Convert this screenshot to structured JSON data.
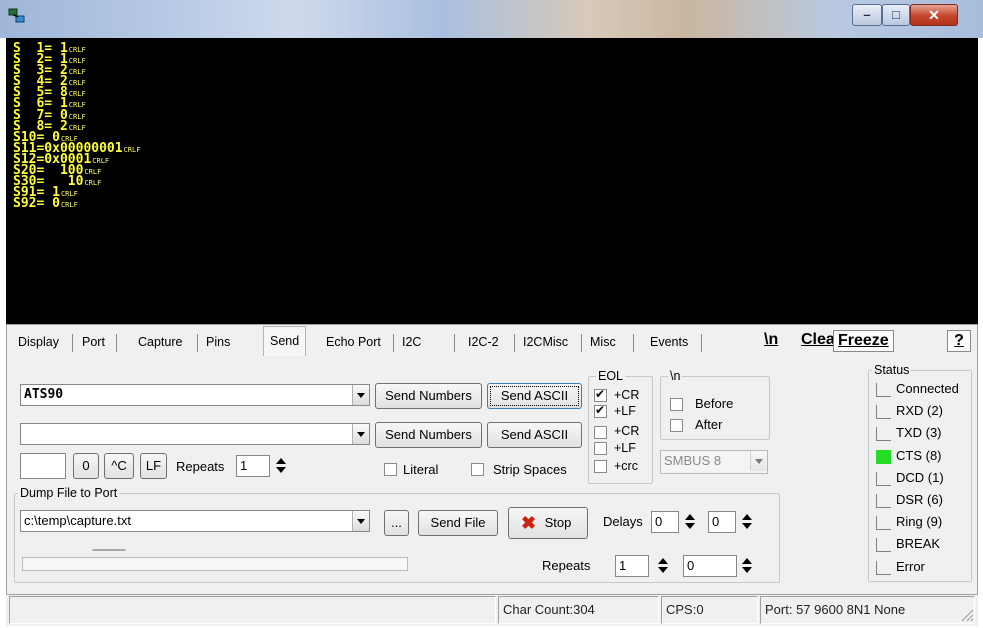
{
  "terminal": {
    "lines": [
      {
        "text": "S  1= 1",
        "end": "CRLF"
      },
      {
        "text": "S  2= 1",
        "end": "CRLF"
      },
      {
        "text": "S  3= 2",
        "end": "CRLF"
      },
      {
        "text": "S  4= 2",
        "end": "CRLF"
      },
      {
        "text": "S  5= 8",
        "end": "CRLF"
      },
      {
        "text": "S  6= 1",
        "end": "CRLF"
      },
      {
        "text": "S  7= 0",
        "end": "CRLF"
      },
      {
        "text": "S  8= 2",
        "end": "CRLF"
      },
      {
        "text": "S10= 0",
        "end": "CRLF"
      },
      {
        "text": "S11=0x00000001",
        "end": "CRLF"
      },
      {
        "text": "S12=0x0001",
        "end": "CRLF"
      },
      {
        "text": "S20=  100",
        "end": "CRLF"
      },
      {
        "text": "S30=   10",
        "end": "CRLF"
      },
      {
        "text": "S91= 1",
        "end": "CRLF"
      },
      {
        "text": "S92= 0",
        "end": "CRLF"
      }
    ]
  },
  "tabs": [
    "Display",
    "Port",
    "Capture",
    "Pins",
    "Send",
    "Echo Port",
    "I2C",
    "I2C-2",
    "I2CMisc",
    "Misc",
    "Events"
  ],
  "active_tab": "Send",
  "toolbar": {
    "newline": "\\n",
    "clear": "Clear",
    "freeze": "Freeze",
    "help": "?"
  },
  "send": {
    "line1_value": "ATS90",
    "line2_value": "",
    "send_numbers": "Send Numbers",
    "send_ascii": "Send ASCII",
    "char_value": "",
    "zero": "0",
    "ctrl_c": "^C",
    "lf": "LF",
    "repeats_label": "Repeats",
    "repeats_value": "1",
    "literal": "Literal",
    "strip_spaces": "Strip Spaces",
    "eol_title": "EOL",
    "eol_options": [
      {
        "label": "+CR",
        "checked": true
      },
      {
        "label": "+LF",
        "checked": true
      },
      {
        "label": "+CR",
        "checked": false
      },
      {
        "label": "+LF",
        "checked": false
      },
      {
        "label": "+crc",
        "checked": false
      }
    ],
    "newline_title": "\\n",
    "before": "Before",
    "after": "After",
    "smbus_value": "SMBUS 8"
  },
  "dump": {
    "title": "Dump File to Port",
    "file_path": "c:\\temp\\capture.txt",
    "browse": "...",
    "send_file": "Send File",
    "stop": "Stop",
    "delays_label": "Delays",
    "delay1": "0",
    "delay2": "0",
    "repeats_label": "Repeats",
    "repeat1": "1",
    "repeat2": "0",
    "progress_text": "-----------"
  },
  "status": {
    "title": "Status",
    "items": [
      {
        "label": "Connected",
        "on": false
      },
      {
        "label": "RXD (2)",
        "on": false
      },
      {
        "label": "TXD (3)",
        "on": false
      },
      {
        "label": "CTS (8)",
        "on": true
      },
      {
        "label": "DCD (1)",
        "on": false
      },
      {
        "label": "DSR (6)",
        "on": false
      },
      {
        "label": "Ring (9)",
        "on": false
      },
      {
        "label": "BREAK",
        "on": false
      },
      {
        "label": "Error",
        "on": false
      }
    ],
    "led_on_color": "#22dd22"
  },
  "statusbar": {
    "message": "",
    "char_count": "Char Count:304",
    "cps": "CPS:0",
    "port": "Port: 57 9600 8N1 None"
  }
}
